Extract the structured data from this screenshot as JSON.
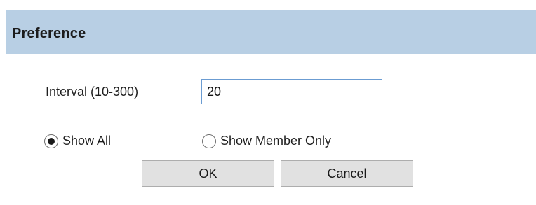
{
  "dialog": {
    "title": "Preference",
    "interval": {
      "label": "Interval (10-300)",
      "value": "20"
    },
    "filter": {
      "options": [
        {
          "label": "Show All",
          "checked": true
        },
        {
          "label": "Show Member Only",
          "checked": false
        }
      ]
    },
    "buttons": {
      "ok": "OK",
      "cancel": "Cancel"
    }
  },
  "colors": {
    "titlebar": "#b8cfe4",
    "input_border": "#6b9cd2",
    "button_bg": "#e1e1e1"
  }
}
